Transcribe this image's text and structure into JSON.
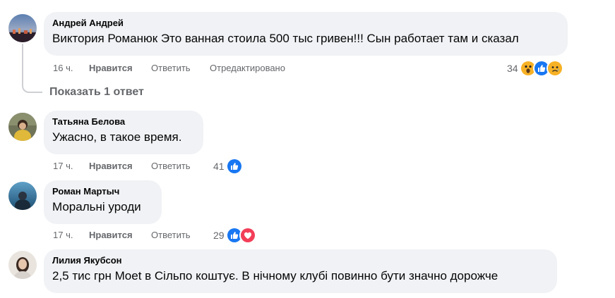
{
  "comments": [
    {
      "author": "Андрей Андрей",
      "text": "Виктория Романюк Это ванная стоила 500 тыс гривен!!! Сын работает там и сказал",
      "time": "16 ч.",
      "like_label": "Нравится",
      "reply_label": "Ответить",
      "edited_label": "Отредактировано",
      "reaction_count": "34",
      "reactions": [
        "wow-icon",
        "like-icon",
        "sad-icon"
      ]
    },
    {
      "author": "Татьяна Белова",
      "text": "Ужасно, в такое время.",
      "time": "17 ч.",
      "like_label": "Нравится",
      "reply_label": "Ответить",
      "reaction_count": "41",
      "reactions": [
        "like-icon"
      ]
    },
    {
      "author": "Роман Мартыч",
      "text": "Моральні уроди",
      "time": "17 ч.",
      "like_label": "Нравится",
      "reply_label": "Ответить",
      "reaction_count": "29",
      "reactions": [
        "like-icon",
        "love-icon"
      ]
    },
    {
      "author": "Лилия Якубсон",
      "text": "2,5 тис грн Moet в Сільпо коштує. В нічному клубі повинно бути значно дорожче"
    }
  ],
  "show_replies_label": "Показать 1 ответ",
  "colors": {
    "bubble": "#f0f2f5",
    "meta_text": "#65676b",
    "like_blue": "#1877f2",
    "love_red": "#f33e58",
    "wow_yellow": "#f7b125"
  }
}
